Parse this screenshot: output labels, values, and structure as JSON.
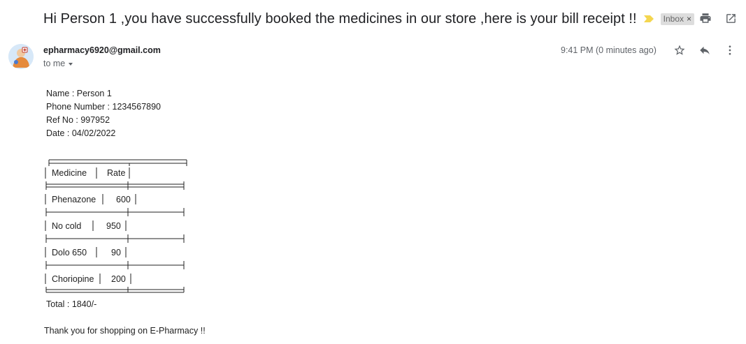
{
  "email": {
    "subject": "Hi Person 1 ,you have successfully booked the medicines in our store ,here is your bill receipt !!",
    "label": "Inbox",
    "label_close": "×",
    "sender": "epharmacy6920@gmail.com",
    "recipient": "to me",
    "time": "9:41 PM (0 minutes ago)"
  },
  "bill": {
    "name_line": "Name : Person 1",
    "phone_line": "Phone Number : 1234567890",
    "ref_line": "Ref No : 997952",
    "date_line": "Date : 04/02/2022",
    "headers": {
      "medicine": "Medicine",
      "rate": "Rate"
    },
    "rows": [
      {
        "medicine": "Phenazone",
        "rate": "600"
      },
      {
        "medicine": "No cold",
        "rate": "950"
      },
      {
        "medicine": "Dolo 650",
        "rate": "90"
      },
      {
        "medicine": "Choriopine",
        "rate": "200"
      }
    ],
    "total_line": "Total : 1840/-",
    "thanks_line": "Thank you for shopping on E-Pharmacy !!"
  },
  "colors": {
    "importance": "#f4d64f",
    "chip_bg": "#dddddd",
    "icon": "#5f6368"
  },
  "icons": [
    "importance-marker-icon",
    "print-icon",
    "open-new-window-icon",
    "star-icon",
    "reply-icon",
    "more-vert-icon",
    "caret-down-icon"
  ]
}
